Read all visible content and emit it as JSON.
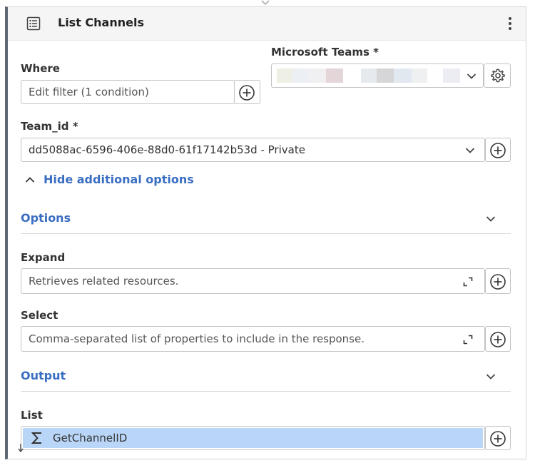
{
  "header": {
    "title": "List Channels",
    "icon": "list-icon",
    "menu_icon": "more-vertical-icon"
  },
  "where": {
    "label": "Where",
    "filter_value": "Edit filter (1 condition)"
  },
  "connection": {
    "label": "Microsoft Teams *",
    "icon": "gear-icon"
  },
  "team": {
    "label": "Team_id *",
    "value": "dd5088ac-6596-406e-88d0-61f17142b53d - Private"
  },
  "toggle_link": "Hide additional options",
  "options": {
    "title": "Options"
  },
  "expand": {
    "label": "Expand",
    "placeholder": "Retrieves related resources."
  },
  "select": {
    "label": "Select",
    "placeholder": "Comma-separated list of properties to include in the response."
  },
  "output": {
    "title": "Output"
  },
  "list": {
    "label": "List",
    "value": "GetChannelID",
    "icon": "sigma-icon"
  },
  "colors": {
    "accent": "#3a6ec2",
    "chip": "#b9d6f8",
    "rail": "#5f6873"
  }
}
